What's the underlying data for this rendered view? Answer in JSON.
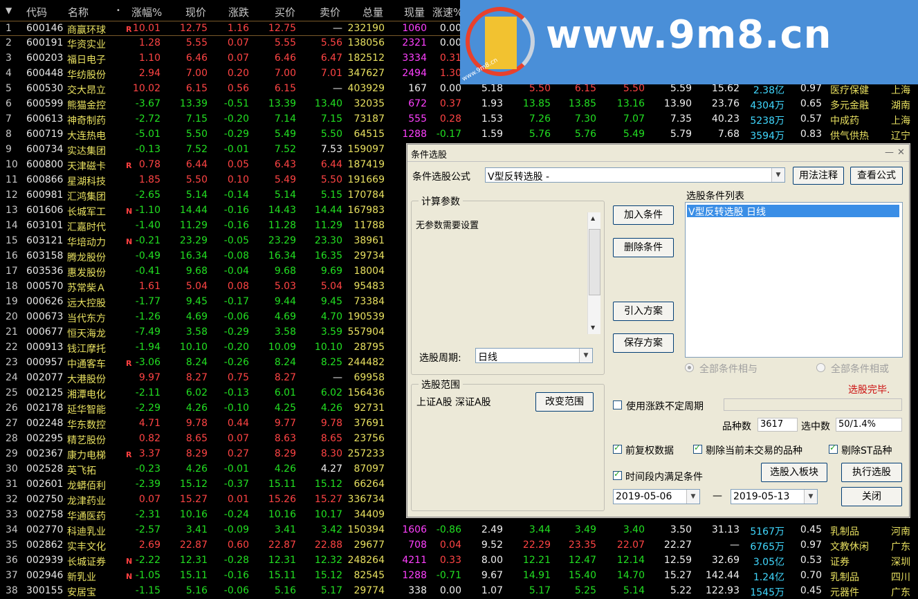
{
  "header": {
    "sort_icon": "▼",
    "cols": [
      "代码",
      "名称",
      "•",
      "涨幅%",
      "现价",
      "涨跌",
      "买价",
      "卖价",
      "总量",
      "现量",
      "涨速%"
    ]
  },
  "rows": [
    {
      "i": "1",
      "code": "600146",
      "name": "商赢环球",
      "f": "R",
      "pct": "10.01",
      "px": "12.75",
      "chg": "1.16",
      "bid": "12.75",
      "ask": "—",
      "vol": "232190",
      "cur": "1060",
      "spd": "0.00",
      "pc": "red",
      "ac": "white",
      "cc": "mag",
      "sc": "white"
    },
    {
      "i": "2",
      "code": "600191",
      "name": "华资实业",
      "f": "",
      "pct": "1.28",
      "px": "5.55",
      "chg": "0.07",
      "bid": "5.55",
      "ask": "5.56",
      "vol": "138056",
      "cur": "2321",
      "spd": "0.00",
      "pc": "red",
      "ac": "red",
      "cc": "mag",
      "sc": "white"
    },
    {
      "i": "3",
      "code": "600203",
      "name": "福日电子",
      "f": "",
      "pct": "1.10",
      "px": "6.46",
      "chg": "0.07",
      "bid": "6.46",
      "ask": "6.47",
      "vol": "182512",
      "cur": "3334",
      "spd": "0.31",
      "pc": "red",
      "ac": "red",
      "cc": "mag",
      "sc": "red"
    },
    {
      "i": "4",
      "code": "600448",
      "name": "华纺股份",
      "f": "",
      "pct": "2.94",
      "px": "7.00",
      "chg": "0.20",
      "bid": "7.00",
      "ask": "7.01",
      "vol": "347627",
      "cur": "2494",
      "spd": "1.30",
      "pc": "red",
      "ac": "red",
      "cc": "mag",
      "sc": "red"
    },
    {
      "i": "5",
      "code": "600530",
      "name": "交大昂立",
      "f": "",
      "pct": "10.02",
      "px": "6.15",
      "chg": "0.56",
      "bid": "6.15",
      "ask": "—",
      "vol": "403929",
      "cur": "167",
      "spd": "0.00",
      "pc": "red",
      "ac": "white",
      "cc": "white",
      "sc": "white"
    },
    {
      "i": "6",
      "code": "600599",
      "name": "熊猫金控",
      "f": "",
      "pct": "-3.67",
      "px": "13.39",
      "chg": "-0.51",
      "bid": "13.39",
      "ask": "13.40",
      "vol": "32035",
      "cur": "672",
      "spd": "0.37",
      "pc": "green",
      "ac": "green",
      "cc": "mag",
      "sc": "red"
    },
    {
      "i": "7",
      "code": "600613",
      "name": "神奇制药",
      "f": "",
      "pct": "-2.72",
      "px": "7.15",
      "chg": "-0.20",
      "bid": "7.14",
      "ask": "7.15",
      "vol": "73187",
      "cur": "555",
      "spd": "0.28",
      "pc": "green",
      "ac": "green",
      "cc": "mag",
      "sc": "red"
    },
    {
      "i": "8",
      "code": "600719",
      "name": "大连热电",
      "f": "",
      "pct": "-5.01",
      "px": "5.50",
      "chg": "-0.29",
      "bid": "5.49",
      "ask": "5.50",
      "vol": "64515",
      "cur": "1288",
      "spd": "-0.17",
      "pc": "green",
      "ac": "green",
      "cc": "mag",
      "sc": "green"
    },
    {
      "i": "9",
      "code": "600734",
      "name": "实达集团",
      "f": "",
      "pct": "-0.13",
      "px": "7.52",
      "chg": "-0.01",
      "bid": "7.52",
      "ask": "7.53",
      "vol": "159097",
      "cur": "",
      "spd": "",
      "pc": "green",
      "ac": "white",
      "cc": "white",
      "sc": "white"
    },
    {
      "i": "10",
      "code": "600800",
      "name": "天津磁卡",
      "f": "R",
      "pct": "0.78",
      "px": "6.44",
      "chg": "0.05",
      "bid": "6.43",
      "ask": "6.44",
      "vol": "187419",
      "cur": "",
      "spd": "",
      "pc": "red",
      "ac": "red",
      "cc": "white",
      "sc": "white"
    },
    {
      "i": "11",
      "code": "600866",
      "name": "星湖科技",
      "f": "",
      "pct": "1.85",
      "px": "5.50",
      "chg": "0.10",
      "bid": "5.49",
      "ask": "5.50",
      "vol": "191669",
      "cur": "",
      "spd": "",
      "pc": "red",
      "ac": "red",
      "cc": "white",
      "sc": "white"
    },
    {
      "i": "12",
      "code": "600981",
      "name": "汇鸿集团",
      "f": "",
      "pct": "-2.65",
      "px": "5.14",
      "chg": "-0.14",
      "bid": "5.14",
      "ask": "5.15",
      "vol": "170784",
      "cur": "",
      "spd": "",
      "pc": "green",
      "ac": "green",
      "cc": "white",
      "sc": "white"
    },
    {
      "i": "13",
      "code": "601606",
      "name": "长城军工",
      "f": "N",
      "pct": "-1.10",
      "px": "14.44",
      "chg": "-0.16",
      "bid": "14.43",
      "ask": "14.44",
      "vol": "167983",
      "cur": "",
      "spd": "",
      "pc": "green",
      "ac": "green",
      "cc": "white",
      "sc": "white"
    },
    {
      "i": "14",
      "code": "603101",
      "name": "汇嘉时代",
      "f": "",
      "pct": "-1.40",
      "px": "11.29",
      "chg": "-0.16",
      "bid": "11.28",
      "ask": "11.29",
      "vol": "11788",
      "cur": "",
      "spd": "",
      "pc": "green",
      "ac": "green",
      "cc": "white",
      "sc": "white"
    },
    {
      "i": "15",
      "code": "603121",
      "name": "华培动力",
      "f": "N",
      "pct": "-0.21",
      "px": "23.29",
      "chg": "-0.05",
      "bid": "23.29",
      "ask": "23.30",
      "vol": "38961",
      "cur": "",
      "spd": "",
      "pc": "green",
      "ac": "green",
      "cc": "white",
      "sc": "white"
    },
    {
      "i": "16",
      "code": "603158",
      "name": "腾龙股份",
      "f": "",
      "pct": "-0.49",
      "px": "16.34",
      "chg": "-0.08",
      "bid": "16.34",
      "ask": "16.35",
      "vol": "29734",
      "cur": "",
      "spd": "",
      "pc": "green",
      "ac": "green",
      "cc": "white",
      "sc": "white"
    },
    {
      "i": "17",
      "code": "603536",
      "name": "惠发股份",
      "f": "",
      "pct": "-0.41",
      "px": "9.68",
      "chg": "-0.04",
      "bid": "9.68",
      "ask": "9.69",
      "vol": "18004",
      "cur": "",
      "spd": "",
      "pc": "green",
      "ac": "green",
      "cc": "white",
      "sc": "white"
    },
    {
      "i": "18",
      "code": "000570",
      "name": "苏常柴Ａ",
      "f": "",
      "pct": "1.61",
      "px": "5.04",
      "chg": "0.08",
      "bid": "5.03",
      "ask": "5.04",
      "vol": "95483",
      "cur": "",
      "spd": "",
      "pc": "red",
      "ac": "red",
      "cc": "white",
      "sc": "white"
    },
    {
      "i": "19",
      "code": "000626",
      "name": "远大控股",
      "f": "",
      "pct": "-1.77",
      "px": "9.45",
      "chg": "-0.17",
      "bid": "9.44",
      "ask": "9.45",
      "vol": "73384",
      "cur": "",
      "spd": "",
      "pc": "green",
      "ac": "green",
      "cc": "white",
      "sc": "white"
    },
    {
      "i": "20",
      "code": "000673",
      "name": "当代东方",
      "f": "",
      "pct": "-1.26",
      "px": "4.69",
      "chg": "-0.06",
      "bid": "4.69",
      "ask": "4.70",
      "vol": "190539",
      "cur": "",
      "spd": "",
      "pc": "green",
      "ac": "green",
      "cc": "white",
      "sc": "white"
    },
    {
      "i": "21",
      "code": "000677",
      "name": "恒天海龙",
      "f": "",
      "pct": "-7.49",
      "px": "3.58",
      "chg": "-0.29",
      "bid": "3.58",
      "ask": "3.59",
      "vol": "557904",
      "cur": "",
      "spd": "",
      "pc": "green",
      "ac": "green",
      "cc": "white",
      "sc": "white"
    },
    {
      "i": "22",
      "code": "000913",
      "name": "钱江摩托",
      "f": "",
      "pct": "-1.94",
      "px": "10.10",
      "chg": "-0.20",
      "bid": "10.09",
      "ask": "10.10",
      "vol": "28795",
      "cur": "",
      "spd": "",
      "pc": "green",
      "ac": "green",
      "cc": "white",
      "sc": "white"
    },
    {
      "i": "23",
      "code": "000957",
      "name": "中通客车",
      "f": "R",
      "pct": "-3.06",
      "px": "8.24",
      "chg": "-0.26",
      "bid": "8.24",
      "ask": "8.25",
      "vol": "244482",
      "cur": "",
      "spd": "",
      "pc": "green",
      "ac": "green",
      "cc": "white",
      "sc": "white"
    },
    {
      "i": "24",
      "code": "002077",
      "name": "大港股份",
      "f": "",
      "pct": "9.97",
      "px": "8.27",
      "chg": "0.75",
      "bid": "8.27",
      "ask": "—",
      "vol": "69958",
      "cur": "",
      "spd": "",
      "pc": "red",
      "ac": "white",
      "cc": "white",
      "sc": "white"
    },
    {
      "i": "25",
      "code": "002125",
      "name": "湘潭电化",
      "f": "",
      "pct": "-2.11",
      "px": "6.02",
      "chg": "-0.13",
      "bid": "6.01",
      "ask": "6.02",
      "vol": "156436",
      "cur": "",
      "spd": "",
      "pc": "green",
      "ac": "green",
      "cc": "white",
      "sc": "white"
    },
    {
      "i": "26",
      "code": "002178",
      "name": "延华智能",
      "f": "",
      "pct": "-2.29",
      "px": "4.26",
      "chg": "-0.10",
      "bid": "4.25",
      "ask": "4.26",
      "vol": "92731",
      "cur": "",
      "spd": "",
      "pc": "green",
      "ac": "green",
      "cc": "white",
      "sc": "white"
    },
    {
      "i": "27",
      "code": "002248",
      "name": "华东数控",
      "f": "",
      "pct": "4.71",
      "px": "9.78",
      "chg": "0.44",
      "bid": "9.77",
      "ask": "9.78",
      "vol": "37691",
      "cur": "",
      "spd": "",
      "pc": "red",
      "ac": "red",
      "cc": "white",
      "sc": "white"
    },
    {
      "i": "28",
      "code": "002295",
      "name": "精艺股份",
      "f": "",
      "pct": "0.82",
      "px": "8.65",
      "chg": "0.07",
      "bid": "8.63",
      "ask": "8.65",
      "vol": "23756",
      "cur": "",
      "spd": "",
      "pc": "red",
      "ac": "red",
      "cc": "white",
      "sc": "white"
    },
    {
      "i": "29",
      "code": "002367",
      "name": "康力电梯",
      "f": "R",
      "pct": "3.37",
      "px": "8.29",
      "chg": "0.27",
      "bid": "8.29",
      "ask": "8.30",
      "vol": "257233",
      "cur": "",
      "spd": "",
      "pc": "red",
      "ac": "red",
      "cc": "white",
      "sc": "white"
    },
    {
      "i": "30",
      "code": "002528",
      "name": "英飞拓",
      "f": "",
      "pct": "-0.23",
      "px": "4.26",
      "chg": "-0.01",
      "bid": "4.26",
      "ask": "4.27",
      "vol": "87097",
      "cur": "",
      "spd": "",
      "pc": "green",
      "ac": "white",
      "cc": "white",
      "sc": "white"
    },
    {
      "i": "31",
      "code": "002601",
      "name": "龙蟒佰利",
      "f": "",
      "pct": "-2.39",
      "px": "15.12",
      "chg": "-0.37",
      "bid": "15.11",
      "ask": "15.12",
      "vol": "66264",
      "cur": "",
      "spd": "",
      "pc": "green",
      "ac": "green",
      "cc": "white",
      "sc": "white"
    },
    {
      "i": "32",
      "code": "002750",
      "name": "龙津药业",
      "f": "",
      "pct": "0.07",
      "px": "15.27",
      "chg": "0.01",
      "bid": "15.26",
      "ask": "15.27",
      "vol": "336734",
      "cur": "",
      "spd": "",
      "pc": "red",
      "ac": "red",
      "cc": "white",
      "sc": "white"
    },
    {
      "i": "33",
      "code": "002758",
      "name": "华通医药",
      "f": "",
      "pct": "-2.31",
      "px": "10.16",
      "chg": "-0.24",
      "bid": "10.16",
      "ask": "10.17",
      "vol": "34409",
      "cur": "",
      "spd": "",
      "pc": "green",
      "ac": "green",
      "cc": "white",
      "sc": "white"
    },
    {
      "i": "34",
      "code": "002770",
      "name": "科迪乳业",
      "f": "",
      "pct": "-2.57",
      "px": "3.41",
      "chg": "-0.09",
      "bid": "3.41",
      "ask": "3.42",
      "vol": "150394",
      "cur": "1606",
      "spd": "-0.86",
      "pc": "green",
      "ac": "green",
      "cc": "mag",
      "sc": "green"
    },
    {
      "i": "35",
      "code": "002862",
      "name": "实丰文化",
      "f": "",
      "pct": "2.69",
      "px": "22.87",
      "chg": "0.60",
      "bid": "22.87",
      "ask": "22.88",
      "vol": "29677",
      "cur": "708",
      "spd": "0.04",
      "pc": "red",
      "ac": "red",
      "cc": "mag",
      "sc": "red"
    },
    {
      "i": "36",
      "code": "002939",
      "name": "长城证券",
      "f": "N",
      "pct": "-2.22",
      "px": "12.31",
      "chg": "-0.28",
      "bid": "12.31",
      "ask": "12.32",
      "vol": "248264",
      "cur": "4211",
      "spd": "0.33",
      "pc": "green",
      "ac": "green",
      "cc": "mag",
      "sc": "red"
    },
    {
      "i": "37",
      "code": "002946",
      "name": "新乳业",
      "f": "N",
      "pct": "-1.05",
      "px": "15.11",
      "chg": "-0.16",
      "bid": "15.11",
      "ask": "15.12",
      "vol": "82545",
      "cur": "1288",
      "spd": "-0.71",
      "pc": "green",
      "ac": "green",
      "cc": "mag",
      "sc": "green"
    },
    {
      "i": "38",
      "code": "300155",
      "name": "安居宝",
      "f": "",
      "pct": "-1.15",
      "px": "5.16",
      "chg": "-0.06",
      "bid": "5.16",
      "ask": "5.17",
      "vol": "29774",
      "cur": "338",
      "spd": "0.00",
      "pc": "green",
      "ac": "green",
      "cc": "white",
      "sc": "white"
    }
  ],
  "extra_rows": [
    {
      "row": 5,
      "vals": [
        "5.18",
        "5.50",
        "6.15",
        "5.50",
        "5.59",
        "15.62",
        "2.38亿",
        "0.97",
        "医疗保健",
        "上海"
      ]
    },
    {
      "row": 6,
      "vals": [
        "1.93",
        "13.85",
        "13.85",
        "13.16",
        "13.90",
        "23.76",
        "4304万",
        "0.65",
        "多元金融",
        "湖南"
      ]
    },
    {
      "row": 7,
      "vals": [
        "1.53",
        "7.26",
        "7.30",
        "7.07",
        "7.35",
        "40.23",
        "5238万",
        "0.57",
        "中成药",
        "上海"
      ]
    },
    {
      "row": 8,
      "vals": [
        "1.59",
        "5.76",
        "5.76",
        "5.49",
        "5.79",
        "7.68",
        "3594万",
        "0.83",
        "供气供热",
        "辽宁"
      ]
    },
    {
      "row": 34,
      "vals": [
        "2.49",
        "3.44",
        "3.49",
        "3.40",
        "3.50",
        "31.13",
        "5167万",
        "0.45",
        "乳制品",
        "河南"
      ]
    },
    {
      "row": 35,
      "vals": [
        "9.52",
        "22.29",
        "23.35",
        "22.07",
        "22.27",
        "—",
        "6765万",
        "0.97",
        "文教休闲",
        "广东"
      ]
    },
    {
      "row": 36,
      "vals": [
        "8.00",
        "12.21",
        "12.47",
        "12.14",
        "12.59",
        "32.69",
        "3.05亿",
        "0.53",
        "证券",
        "深圳"
      ]
    },
    {
      "row": 37,
      "vals": [
        "9.67",
        "14.91",
        "15.40",
        "14.70",
        "15.27",
        "142.44",
        "1.24亿",
        "0.70",
        "乳制品",
        "四川"
      ]
    },
    {
      "row": 38,
      "vals": [
        "1.07",
        "5.17",
        "5.25",
        "5.14",
        "5.22",
        "122.93",
        "1545万",
        "0.45",
        "元器件",
        "广东"
      ]
    }
  ],
  "dialog": {
    "title": "条件选股",
    "minimize": "—",
    "close": "✕",
    "formula_label": "条件选股公式",
    "formula_value": "V型反转选股  -",
    "usage_btn": "用法注释",
    "view_formula_btn": "查看公式",
    "params_group": "计算参数",
    "params_text": "无参数需要设置",
    "period_label": "选股周期:",
    "period_value": "日线",
    "add_btn": "加入条件",
    "delete_btn": "删除条件",
    "import_btn": "引入方案",
    "save_btn": "保存方案",
    "cond_list_label": "选股条件列表",
    "cond_item": "V型反转选股  日线",
    "all_and": "全部条件相与",
    "all_or": "全部条件相或",
    "done_status": "选股完毕.",
    "range_group": "选股范围",
    "range_text": "上证A股  深证A股",
    "change_range_btn": "改变范围",
    "use_uncertain": "使用涨跌不定周期",
    "count_label": "品种数",
    "count_value": "3617",
    "selected_label": "选中数",
    "selected_value": "50/1.4%",
    "pre_adjust": "前复权数据",
    "exclude_untraded": "剔除当前未交易的品种",
    "exclude_st": "剔除ST品种",
    "time_range": "时间段内满足条件",
    "to_board_btn": "选股入板块",
    "exec_btn": "执行选股",
    "date_from": "2019-05-06",
    "date_sep": "—",
    "date_to": "2019-05-13",
    "close_btn": "关闭"
  },
  "watermark": {
    "url": "www.9m8.cn",
    "small": "www.9m8.cn"
  },
  "colors": {
    "red": "#ff4444",
    "green": "#22e022",
    "magenta": "#ff40ff",
    "cyan": "#40d8ff",
    "yellow": "#e8e060",
    "dialog_bg": "#ece9d8",
    "selection": "#3a8ee6"
  }
}
